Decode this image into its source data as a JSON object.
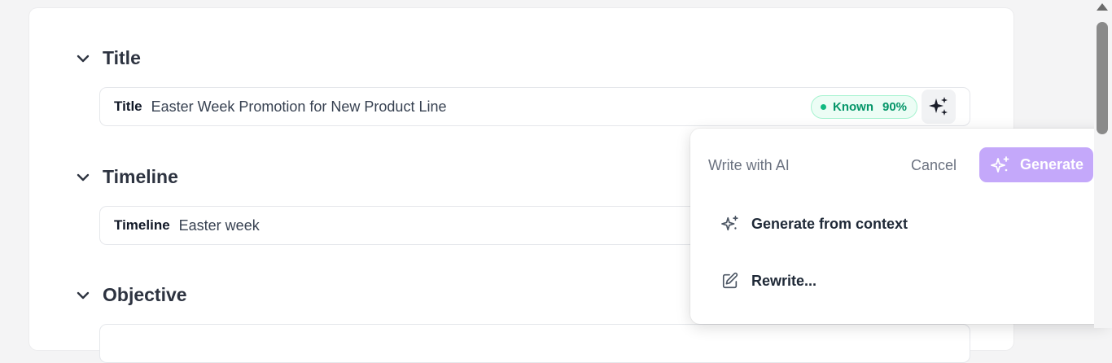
{
  "sections": [
    {
      "heading": "Title",
      "field_label": "Title",
      "field_value": "Easter Week Promotion for New Product Line",
      "badge": {
        "label": "Known",
        "percent": "90%"
      }
    },
    {
      "heading": "Timeline",
      "field_label": "Timeline",
      "field_value": "Easter week"
    },
    {
      "heading": "Objective"
    }
  ],
  "ai_popover": {
    "title": "Write with AI",
    "cancel_label": "Cancel",
    "generate_label": "Generate",
    "menu_items": [
      {
        "label": "Generate from context",
        "icon": "sparkles-icon"
      },
      {
        "label": "Rewrite...",
        "icon": "edit-icon"
      }
    ]
  },
  "colors": {
    "accent_purple": "#c4a8fa",
    "known_green": "#059669",
    "known_bg": "#ecfdf5"
  }
}
